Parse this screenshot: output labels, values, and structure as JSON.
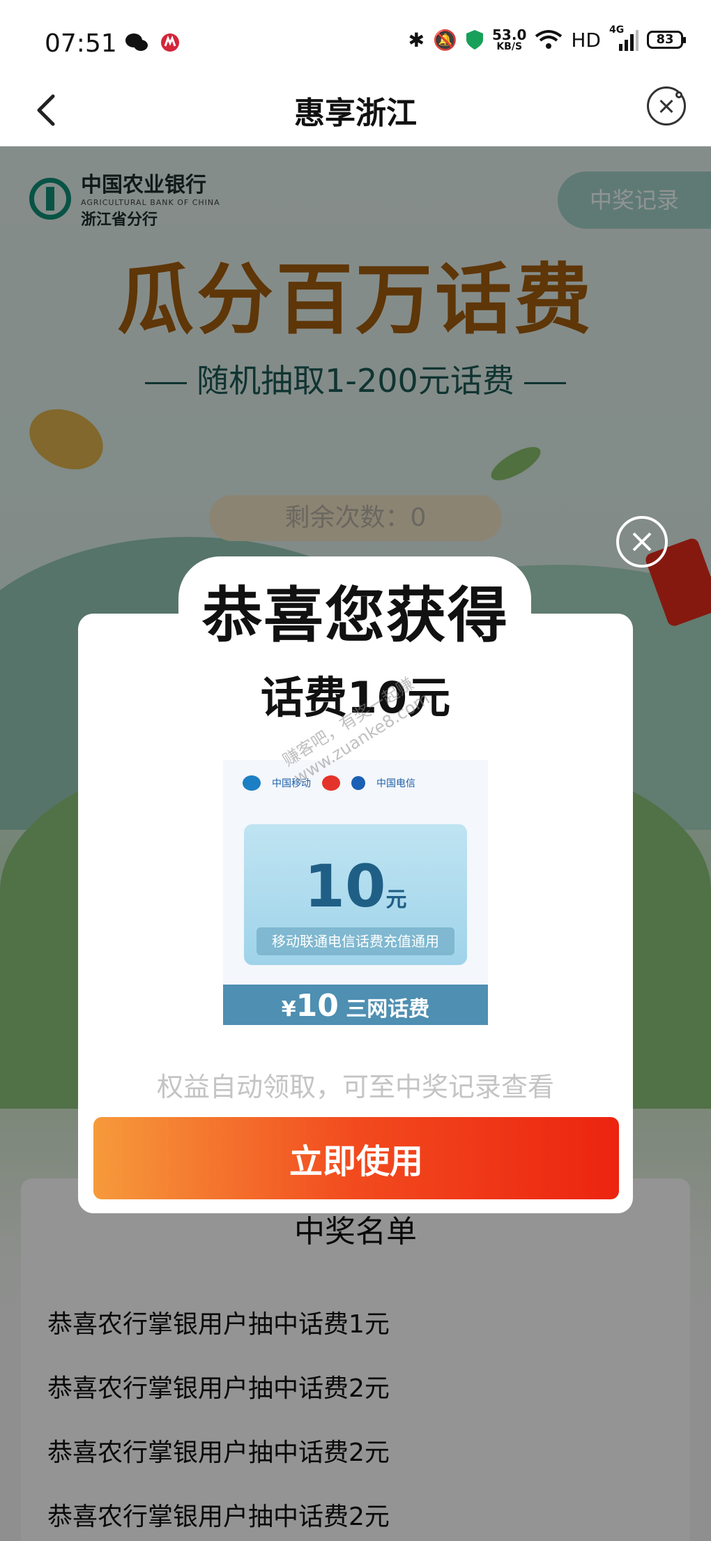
{
  "status_bar": {
    "time": "07:51",
    "net_speed_value": "53.0",
    "net_speed_unit": "KB/S",
    "hd": "HD",
    "signal": "4G",
    "battery": "83"
  },
  "header": {
    "title": "惠享浙江"
  },
  "background_page": {
    "bank_name": "中国农业银行",
    "bank_name_en": "AGRICULTURAL BANK OF CHINA",
    "bank_branch": "浙江省分行",
    "record_button": "中奖记录",
    "hero_title": "瓜分百万话费",
    "hero_subtitle": "随机抽取1-200元话费",
    "remaining_label": "剩余次数：0",
    "winners_title": "中奖名单",
    "winners": [
      "恭喜农行掌银用户抽中话费1元",
      "恭喜农行掌银用户抽中话费2元",
      "恭喜农行掌银用户抽中话费2元",
      "恭喜农行掌银用户抽中话费2元"
    ]
  },
  "modal": {
    "heading": "恭喜您获得",
    "prize_name": "话费10元",
    "card": {
      "logo_mobile": "中国移动",
      "logo_telecom": "中国电信",
      "amount": "10",
      "amount_unit": "元",
      "caption": "移动联通电信话费充值通用",
      "footer_currency": "¥",
      "footer_amount": "10",
      "footer_text": "三网话费"
    },
    "watermark_line1": "赚客吧，有奖一起赚",
    "watermark_line2": "www.zuanke8.com",
    "hint": "权益自动领取，可至中奖记录查看",
    "use_button": "立即使用"
  }
}
